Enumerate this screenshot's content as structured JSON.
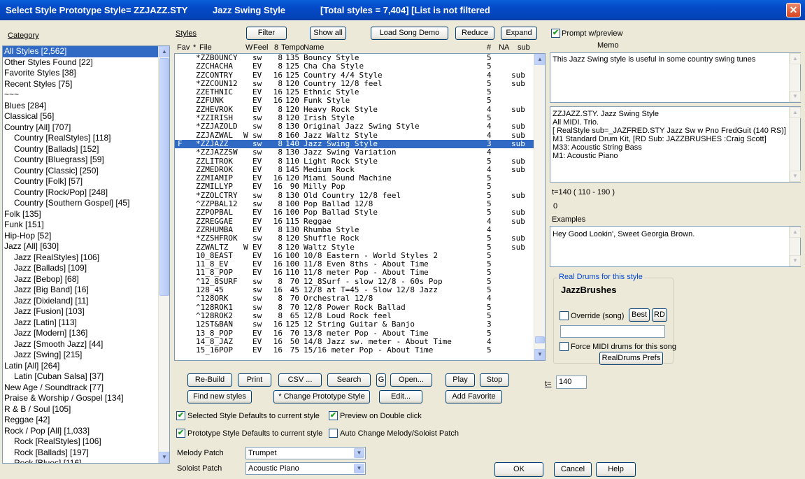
{
  "window": {
    "title_prefix": "Select Style Prototype Style= ZZJAZZ.STY",
    "title_style": "Jazz Swing Style",
    "title_stats": "[Total styles = 7,404] [List is not filtered",
    "close_glyph": "✕"
  },
  "category": {
    "label": "Category",
    "items": [
      {
        "text": "All Styles [2,562]",
        "indent": false,
        "selected": true
      },
      {
        "text": "Other Styles Found [22]",
        "indent": false
      },
      {
        "text": "Favorite Styles [38]",
        "indent": false
      },
      {
        "text": "Recent Styles [75]",
        "indent": false
      },
      {
        "text": "~~~",
        "indent": false
      },
      {
        "text": "Blues [284]",
        "indent": false
      },
      {
        "text": "Classical [56]",
        "indent": false
      },
      {
        "text": "Country [All] [707]",
        "indent": false
      },
      {
        "text": "Country [RealStyles] [118]",
        "indent": true
      },
      {
        "text": "Country [Ballads] [152]",
        "indent": true
      },
      {
        "text": "Country [Bluegrass] [59]",
        "indent": true
      },
      {
        "text": "Country [Classic] [250]",
        "indent": true
      },
      {
        "text": "Country [Folk] [57]",
        "indent": true
      },
      {
        "text": "Country [Rock/Pop] [248]",
        "indent": true
      },
      {
        "text": "Country [Southern Gospel] [45]",
        "indent": true
      },
      {
        "text": "Folk [135]",
        "indent": false
      },
      {
        "text": "Funk [151]",
        "indent": false
      },
      {
        "text": "Hip-Hop [52]",
        "indent": false
      },
      {
        "text": "Jazz [All] [630]",
        "indent": false
      },
      {
        "text": "Jazz [RealStyles] [106]",
        "indent": true
      },
      {
        "text": "Jazz [Ballads] [109]",
        "indent": true
      },
      {
        "text": "Jazz [Bebop] [68]",
        "indent": true
      },
      {
        "text": "Jazz [Big Band] [16]",
        "indent": true
      },
      {
        "text": "Jazz [Dixieland] [11]",
        "indent": true
      },
      {
        "text": "Jazz [Fusion] [103]",
        "indent": true
      },
      {
        "text": "Jazz [Latin] [113]",
        "indent": true
      },
      {
        "text": "Jazz [Modern] [136]",
        "indent": true
      },
      {
        "text": "Jazz [Smooth Jazz] [44]",
        "indent": true
      },
      {
        "text": "Jazz [Swing] [215]",
        "indent": true
      },
      {
        "text": "Latin [All] [264]",
        "indent": false
      },
      {
        "text": "Latin [Cuban Salsa] [37]",
        "indent": true
      },
      {
        "text": "New Age / Soundtrack [77]",
        "indent": false
      },
      {
        "text": "Praise & Worship / Gospel [134]",
        "indent": false
      },
      {
        "text": "R & B / Soul [105]",
        "indent": false
      },
      {
        "text": "Reggae [42]",
        "indent": false
      },
      {
        "text": "Rock / Pop [All] [1,033]",
        "indent": false
      },
      {
        "text": "Rock [RealStyles] [106]",
        "indent": true
      },
      {
        "text": "Rock [Ballads] [197]",
        "indent": true
      },
      {
        "text": "Rock [Blues] [116]",
        "indent": true
      }
    ]
  },
  "styles": {
    "label": "Styles",
    "buttons": {
      "filter": "Filter",
      "show_all": "Show all",
      "load_demo": "Load Song Demo",
      "reduce": "Reduce",
      "expand": "Expand"
    },
    "headers": {
      "fav": "Fav",
      "star": "*",
      "file": "File",
      "w": "W",
      "feel": "Feel",
      "eight": "8",
      "tempo": "Tempo",
      "name": "Name",
      "num": "#",
      "na": "NA",
      "sub": "sub"
    },
    "rows": [
      {
        "fav": "",
        "file": "*ZZBOUNCY",
        "w": "",
        "feel": "sw",
        "e": "8",
        "tempo": "135",
        "name": "Bouncy Style",
        "num": "5",
        "sub": ""
      },
      {
        "fav": "",
        "file": "ZZCHACHA",
        "w": "",
        "feel": "EV",
        "e": "8",
        "tempo": "125",
        "name": "Cha Cha Style",
        "num": "5",
        "sub": ""
      },
      {
        "fav": "",
        "file": "ZZCONTRY",
        "w": "",
        "feel": "EV",
        "e": "16",
        "tempo": "125",
        "name": "Country 4/4 Style",
        "num": "4",
        "sub": "sub"
      },
      {
        "fav": "",
        "file": "*ZZCOUN12",
        "w": "",
        "feel": "sw",
        "e": "8",
        "tempo": "120",
        "name": "Country 12/8 feel",
        "num": "5",
        "sub": "sub"
      },
      {
        "fav": "",
        "file": "ZZETHNIC",
        "w": "",
        "feel": "EV",
        "e": "16",
        "tempo": "125",
        "name": "Ethnic Style",
        "num": "5",
        "sub": ""
      },
      {
        "fav": "",
        "file": "ZZFUNK",
        "w": "",
        "feel": "EV",
        "e": "16",
        "tempo": "120",
        "name": "Funk Style",
        "num": "5",
        "sub": ""
      },
      {
        "fav": "",
        "file": "ZZHEVROK",
        "w": "",
        "feel": "EV",
        "e": "8",
        "tempo": "120",
        "name": "Heavy Rock Style",
        "num": "4",
        "sub": "sub"
      },
      {
        "fav": "",
        "file": "*ZZIRISH",
        "w": "",
        "feel": "sw",
        "e": "8",
        "tempo": "120",
        "name": "Irish Style",
        "num": "5",
        "sub": ""
      },
      {
        "fav": "",
        "file": "*ZZJAZOLD",
        "w": "",
        "feel": "sw",
        "e": "8",
        "tempo": "130",
        "name": "Original Jazz Swing Style",
        "num": "4",
        "sub": "sub"
      },
      {
        "fav": "",
        "file": "ZZJAZWAL",
        "w": "W",
        "feel": "sw",
        "e": "8",
        "tempo": "160",
        "name": "Jazz Waltz Style",
        "num": "4",
        "sub": "sub"
      },
      {
        "fav": "F",
        "file": "*ZZJAZZ",
        "w": "",
        "feel": "sw",
        "e": "8",
        "tempo": "140",
        "name": "Jazz Swing Style",
        "num": "3",
        "sub": "sub",
        "selected": true
      },
      {
        "fav": "",
        "file": "*ZZJAZZSW",
        "w": "",
        "feel": "sw",
        "e": "8",
        "tempo": "130",
        "name": "Jazz Swing Variation",
        "num": "4",
        "sub": ""
      },
      {
        "fav": "",
        "file": "ZZLITROK",
        "w": "",
        "feel": "EV",
        "e": "8",
        "tempo": "110",
        "name": "Light Rock Style",
        "num": "5",
        "sub": "sub"
      },
      {
        "fav": "",
        "file": "ZZMEDROK",
        "w": "",
        "feel": "EV",
        "e": "8",
        "tempo": "145",
        "name": "Medium Rock",
        "num": "4",
        "sub": "sub"
      },
      {
        "fav": "",
        "file": "ZZMIAMIP",
        "w": "",
        "feel": "EV",
        "e": "16",
        "tempo": "120",
        "name": "Miami Sound Machine",
        "num": "5",
        "sub": ""
      },
      {
        "fav": "",
        "file": "ZZMILLYP",
        "w": "",
        "feel": "EV",
        "e": "16",
        "tempo": "90",
        "name": "Milly Pop",
        "num": "5",
        "sub": ""
      },
      {
        "fav": "",
        "file": "*ZZOLCTRY",
        "w": "",
        "feel": "sw",
        "e": "8",
        "tempo": "130",
        "name": "Old Country 12/8 feel",
        "num": "5",
        "sub": "sub"
      },
      {
        "fav": "",
        "file": "^ZZPBAL12",
        "w": "",
        "feel": "sw",
        "e": "8",
        "tempo": "100",
        "name": "Pop Ballad 12/8",
        "num": "5",
        "sub": ""
      },
      {
        "fav": "",
        "file": "ZZPOPBAL",
        "w": "",
        "feel": "EV",
        "e": "16",
        "tempo": "100",
        "name": "Pop Ballad Style",
        "num": "5",
        "sub": "sub"
      },
      {
        "fav": "",
        "file": "ZZREGGAE",
        "w": "",
        "feel": "EV",
        "e": "16",
        "tempo": "115",
        "name": "Reggae",
        "num": "4",
        "sub": "sub"
      },
      {
        "fav": "",
        "file": "ZZRHUMBA",
        "w": "",
        "feel": "EV",
        "e": "8",
        "tempo": "130",
        "name": "Rhumba Style",
        "num": "4",
        "sub": ""
      },
      {
        "fav": "",
        "file": "*ZZSHFROK",
        "w": "",
        "feel": "sw",
        "e": "8",
        "tempo": "120",
        "name": "Shuffle Rock",
        "num": "5",
        "sub": "sub"
      },
      {
        "fav": "",
        "file": "ZZWALTZ",
        "w": "W",
        "feel": "EV",
        "e": "8",
        "tempo": "120",
        "name": "Waltz Style",
        "num": "5",
        "sub": "sub"
      },
      {
        "fav": "",
        "file": "10_8EAST",
        "w": "",
        "feel": "EV",
        "e": "16",
        "tempo": "100",
        "name": "10/8 Eastern - World Styles 2",
        "num": "5",
        "sub": ""
      },
      {
        "fav": "",
        "file": "11_8_EV",
        "w": "",
        "feel": "EV",
        "e": "16",
        "tempo": "100",
        "name": "11/8 Even 8ths - About Time",
        "num": "5",
        "sub": ""
      },
      {
        "fav": "",
        "file": "11_8_POP",
        "w": "",
        "feel": "EV",
        "e": "16",
        "tempo": "110",
        "name": "11/8 meter Pop - About Time",
        "num": "5",
        "sub": ""
      },
      {
        "fav": "",
        "file": "^12_8SURF",
        "w": "",
        "feel": "sw",
        "e": "8",
        "tempo": "70",
        "name": "12_8Surf - slow 12/8 - 60s Pop",
        "num": "5",
        "sub": ""
      },
      {
        "fav": "",
        "file": "128_45",
        "w": "",
        "feel": "sw",
        "e": "16",
        "tempo": "45",
        "name": "12/8 at T=45 - Slow 12/8 Jazz",
        "num": "5",
        "sub": ""
      },
      {
        "fav": "",
        "file": "^128ORK",
        "w": "",
        "feel": "sw",
        "e": "8",
        "tempo": "70",
        "name": "Orchestral 12/8",
        "num": "4",
        "sub": ""
      },
      {
        "fav": "",
        "file": "^128ROK1",
        "w": "",
        "feel": "sw",
        "e": "8",
        "tempo": "70",
        "name": "12/8 Power Rock Ballad",
        "num": "5",
        "sub": ""
      },
      {
        "fav": "",
        "file": "^128ROK2",
        "w": "",
        "feel": "sw",
        "e": "8",
        "tempo": "65",
        "name": "12/8 Loud Rock feel",
        "num": "5",
        "sub": ""
      },
      {
        "fav": "",
        "file": "12ST&BAN",
        "w": "",
        "feel": "sw",
        "e": "16",
        "tempo": "125",
        "name": "12 String Guitar & Banjo",
        "num": "3",
        "sub": ""
      },
      {
        "fav": "",
        "file": "13_8_POP",
        "w": "",
        "feel": "EV",
        "e": "16",
        "tempo": "70",
        "name": "13/8 meter Pop - About Time",
        "num": "5",
        "sub": ""
      },
      {
        "fav": "",
        "file": "14_8_JAZ",
        "w": "",
        "feel": "EV",
        "e": "16",
        "tempo": "50",
        "name": "14/8 Jazz sw. meter - About Time",
        "num": "4",
        "sub": ""
      },
      {
        "fav": "",
        "file": "15_16POP",
        "w": "",
        "feel": "EV",
        "e": "16",
        "tempo": "75",
        "name": "15/16 meter Pop - About Time",
        "num": "5",
        "sub": ""
      }
    ]
  },
  "actions": {
    "rebuild": "Re-Build",
    "print": "Print",
    "csv": "CSV ...",
    "search": "Search",
    "g": "G",
    "open": "Open...",
    "play": "Play",
    "stop": "Stop",
    "find_new": "Find new styles",
    "change_proto": "* Change Prototype Style",
    "edit": "Edit...",
    "add_fav": "Add Favorite"
  },
  "options": {
    "selected_defaults": {
      "label": "Selected Style Defaults to current style",
      "checked": true
    },
    "preview_double": {
      "label": "Preview on Double click",
      "checked": true
    },
    "proto_defaults": {
      "label": "Prototype Style Defaults to current style",
      "checked": true
    },
    "auto_change": {
      "label": "Auto Change Melody/Soloist Patch",
      "checked": false
    }
  },
  "patches": {
    "melody_label": "Melody Patch",
    "melody_value": "Trumpet",
    "soloist_label": "Soloist Patch",
    "soloist_value": "Acoustic Piano"
  },
  "right": {
    "prompt_label": "Prompt w/preview",
    "prompt_checked": true,
    "memo_label": "Memo",
    "memo_text": "This Jazz Swing style is useful in some country swing tunes",
    "info_lines": [
      "ZZJAZZ.STY. Jazz Swing Style",
      "All MIDI. Trio.",
      "[ RealStyle sub=_JAZFRED.STY Jazz Sw w Pno FredGuit (140 RS)]",
      "M1 Standard Drum Kit, [RD Sub: JAZZBRUSHES :Craig Scott]",
      "M33: Acoustic String Bass",
      "M1: Acoustic Piano"
    ],
    "tempo_range": "t=140 ( 110 - 190 )",
    "zero": "0",
    "examples_label": "Examples",
    "examples_text": "Hey Good Lookin', Sweet Georgia Brown.",
    "rd_group": "Real Drums for this style",
    "rd_name": "JazzBrushes",
    "override_label": "Override (song)",
    "best": "Best",
    "rd": "RD",
    "force_midi_label": "Force MIDI drums for this song",
    "rd_prefs": "RealDrums Prefs",
    "tempo_label": "t=",
    "tempo_value": "140"
  },
  "footer": {
    "ok": "OK",
    "cancel": "Cancel",
    "help": "Help"
  },
  "colors": {
    "selection": "#316ac5",
    "titlebar": "#0449c7",
    "dialog_bg": "#ece9d8",
    "group_title": "#0046d5"
  }
}
